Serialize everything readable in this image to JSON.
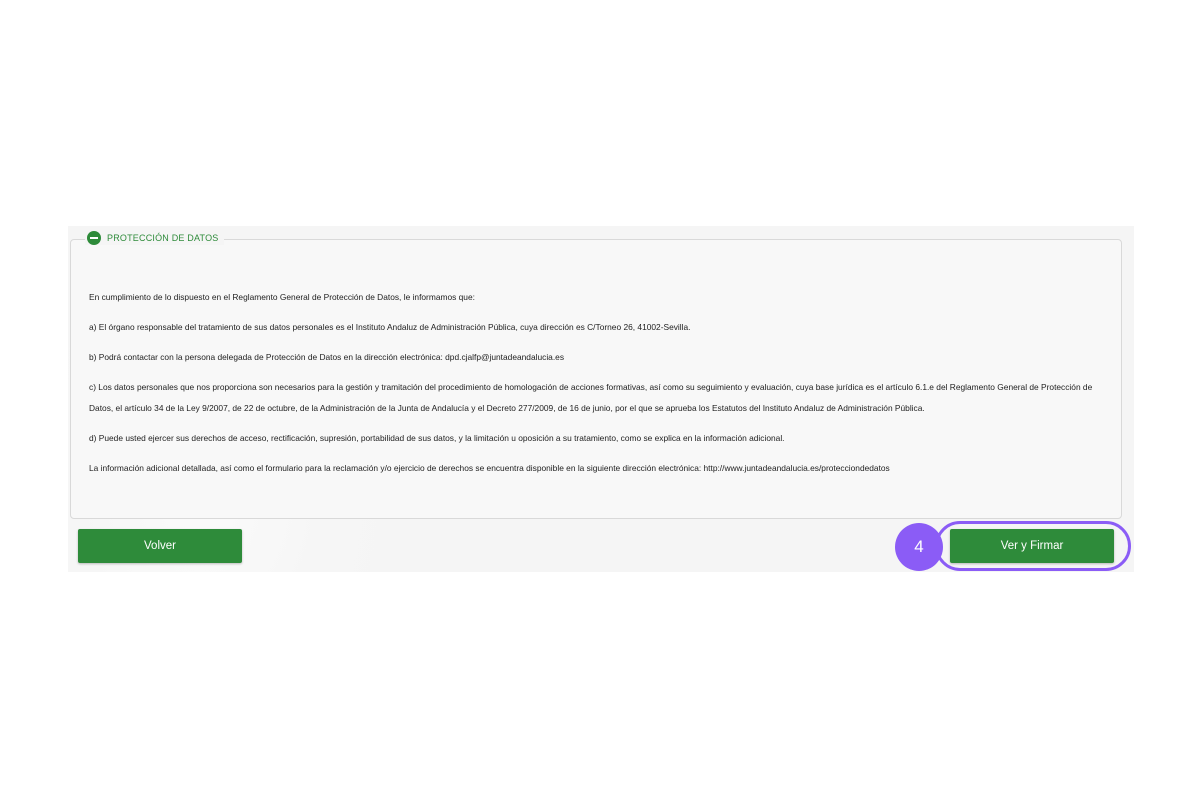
{
  "section": {
    "title": "PROTECCIÓN DE DATOS",
    "paragraphs": [
      "En cumplimiento de lo dispuesto en el Reglamento General de Protección de Datos, le informamos que:",
      "a) El órgano responsable del tratamiento de sus datos personales es el Instituto Andaluz de Administración Pública, cuya dirección es C/Torneo 26, 41002-Sevilla.",
      "b) Podrá contactar con la persona delegada de Protección de Datos en la dirección electrónica: dpd.cjalfp@juntadeandalucia.es",
      "c) Los datos personales que nos proporciona son necesarios para la gestión y tramitación del procedimiento de homologación de acciones formativas, así como su seguimiento y evaluación, cuya base jurídica es el artículo 6.1.e del Reglamento General de Protección de Datos, el artículo 34 de la Ley 9/2007, de 22 de octubre, de la Administración de la Junta de Andalucía y el Decreto 277/2009, de 16 de junio, por el que se aprueba los Estatutos del Instituto Andaluz de Administración Pública.",
      "d) Puede usted ejercer sus derechos de acceso, rectificación, supresión, portabilidad de sus datos, y la limitación u oposición a su tratamiento, como se explica en la información adicional.",
      "La información adicional detallada, así como el formulario para la reclamación y/o ejercicio de derechos se encuentra disponible en la siguiente dirección electrónica: http://www.juntadeandalucia.es/protecciondedatos"
    ]
  },
  "buttons": {
    "back_label": "Volver",
    "sign_label": "Ver y Firmar"
  },
  "annotation": {
    "step_number": "4"
  },
  "colors": {
    "primary_green": "#2e8b3a",
    "annotation_purple": "#8b5cf6"
  },
  "icons": {
    "section_toggle": "collapse-minus-icon"
  }
}
